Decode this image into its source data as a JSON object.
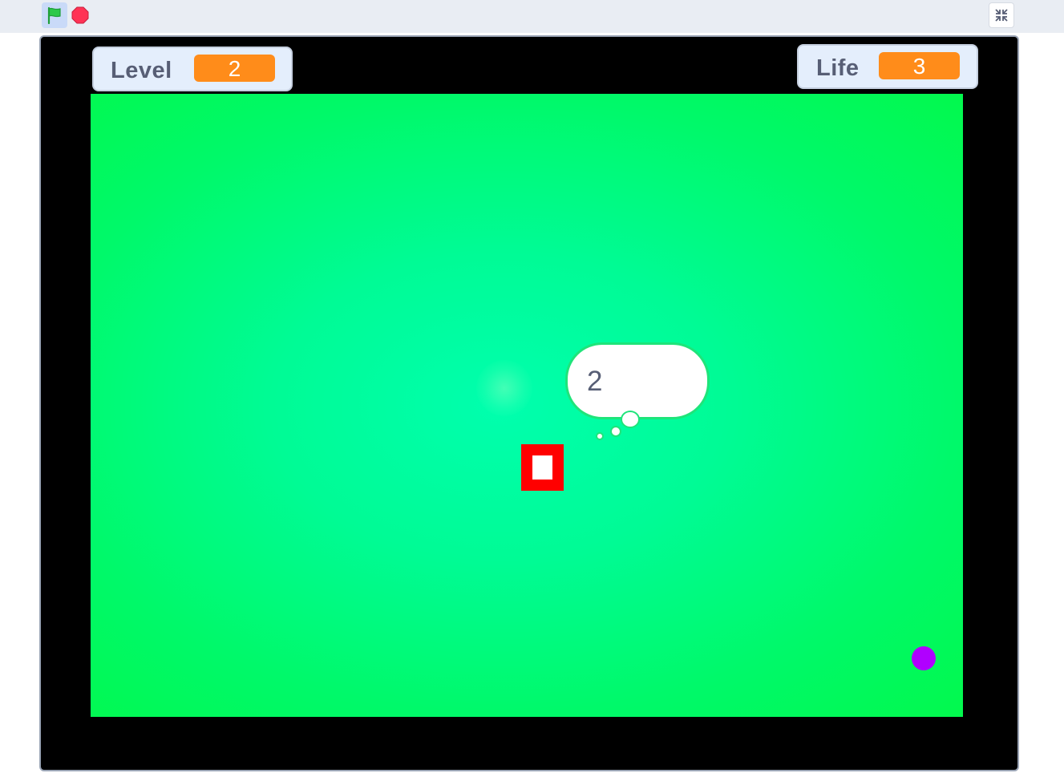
{
  "toolbar": {
    "green_flag_icon": "green-flag-icon",
    "stop_icon": "stop-sign-icon",
    "fullscreen_icon": "exit-fullscreen-icon"
  },
  "monitors": {
    "level": {
      "label": "Level",
      "value": "2"
    },
    "life": {
      "label": "Life",
      "value": "3"
    }
  },
  "bubble": {
    "text": "2"
  },
  "colors": {
    "monitor_value_bg": "#ff8c1a",
    "play_area_center": "#00ffae",
    "play_area_edge": "#02f94d",
    "player": "#ff0000",
    "ball": "#b000ff",
    "stop": "#ff3355",
    "flag": "#2cc94a"
  }
}
